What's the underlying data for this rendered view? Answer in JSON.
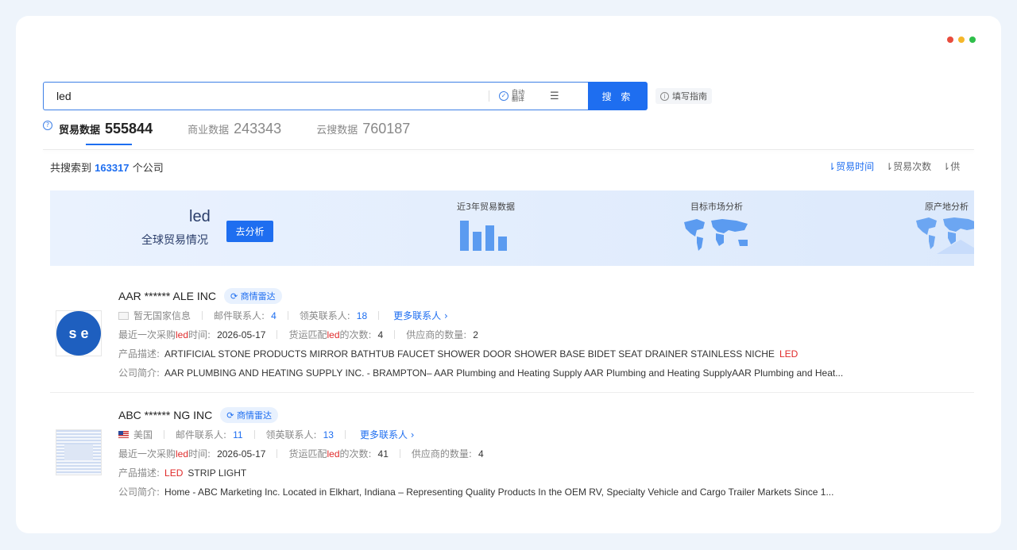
{
  "window_dots": [
    "#e84c3d",
    "#f5b72a",
    "#2fbf4a"
  ],
  "search": {
    "value": "led",
    "auto_translate_line1": "自动",
    "auto_translate_line2": "翻译",
    "button_label": "搜 索",
    "guide_label": "填写指南"
  },
  "tabs": [
    {
      "label": "贸易数据",
      "count": "555844",
      "active": true
    },
    {
      "label": "商业数据",
      "count": "243343",
      "active": false
    },
    {
      "label": "云搜数据",
      "count": "760187",
      "active": false
    }
  ],
  "summary": {
    "prefix": "共搜索到",
    "count": "163317",
    "suffix": "个公司"
  },
  "sorts": [
    {
      "label": "贸易时间",
      "icon": "sort-desc-icon",
      "active": true
    },
    {
      "label": "贸易次数",
      "icon": "sort-desc-icon",
      "active": false
    },
    {
      "label": "供",
      "icon": "sort-desc-icon",
      "active": false
    }
  ],
  "banner": {
    "keyword": "led",
    "subtitle": "全球贸易情况",
    "analyze_label": "去分析",
    "section1": "近3年贸易数据",
    "section2": "目标市场分析",
    "section3": "原产地分析"
  },
  "companies": [
    {
      "name": "AAR ****** ALE INC",
      "radar_label": "商情雷达",
      "logo_text": "s  e",
      "country": "暂无国家信息",
      "email_label": "邮件联系人:",
      "email_count": "4",
      "linkedin_label": "领英联系人:",
      "linkedin_count": "18",
      "more_contacts": "更多联系人",
      "last_purchase_prefix": "最近一次采购",
      "keyword": "led",
      "last_purchase_suffix": "时间:",
      "last_date": "2026-05-17",
      "match_prefix": "货运匹配",
      "match_suffix": "的次数:",
      "match_count": "4",
      "supplier_label": "供应商的数量:",
      "supplier_count": "2",
      "product_label": "产品描述:",
      "product_text": "ARTIFICIAL STONE PRODUCTS MIRROR BATHTUB FAUCET SHOWER DOOR SHOWER BASE BIDET SEAT DRAINER STAINLESS NICHE",
      "product_highlight": "LED",
      "intro_label": "公司简介:",
      "intro_text": "AAR PLUMBING AND HEATING SUPPLY INC. - BRAMPTON– AAR Plumbing and Heating Supply AAR Plumbing and Heating SupplyAAR Plumbing and Heat..."
    },
    {
      "name": "ABC ****** NG INC",
      "radar_label": "商情雷达",
      "country": "美国",
      "email_label": "邮件联系人:",
      "email_count": "11",
      "linkedin_label": "领英联系人:",
      "linkedin_count": "13",
      "more_contacts": "更多联系人",
      "last_purchase_prefix": "最近一次采购",
      "keyword": "led",
      "last_purchase_suffix": "时间:",
      "last_date": "2026-05-17",
      "match_prefix": "货运匹配",
      "match_suffix": "的次数:",
      "match_count": "41",
      "supplier_label": "供应商的数量:",
      "supplier_count": "4",
      "product_label": "产品描述:",
      "product_highlight": "LED",
      "product_text": "STRIP LIGHT",
      "intro_label": "公司简介:",
      "intro_text": "Home - ABC Marketing Inc. Located in Elkhart, Indiana – Representing Quality Products In the OEM RV, Specialty Vehicle and Cargo Trailer Markets Since 1..."
    }
  ]
}
